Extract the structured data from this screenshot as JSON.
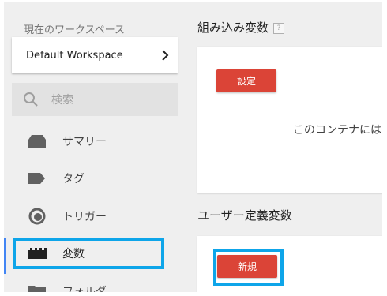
{
  "sidebar": {
    "workspace_caption": "現在のワークスペース",
    "workspace_name": "Default Workspace",
    "search_placeholder": "検索",
    "nav_items": [
      {
        "label": "サマリー",
        "icon": "summary-icon"
      },
      {
        "label": "タグ",
        "icon": "tag-icon"
      },
      {
        "label": "トリガー",
        "icon": "trigger-icon"
      },
      {
        "label": "変数",
        "icon": "variables-icon",
        "active": true
      },
      {
        "label": "フォルダ",
        "icon": "folder-icon"
      }
    ]
  },
  "main": {
    "builtin": {
      "title": "組み込み変数",
      "help": "?",
      "configure_label": "設定",
      "empty_message": "このコンテナには"
    },
    "user_defined": {
      "title": "ユーザー定義変数",
      "new_label": "新規"
    }
  },
  "colors": {
    "accent_red": "#db4437",
    "active_indicator": "#4285f4",
    "highlight": "#0ea5e9"
  }
}
